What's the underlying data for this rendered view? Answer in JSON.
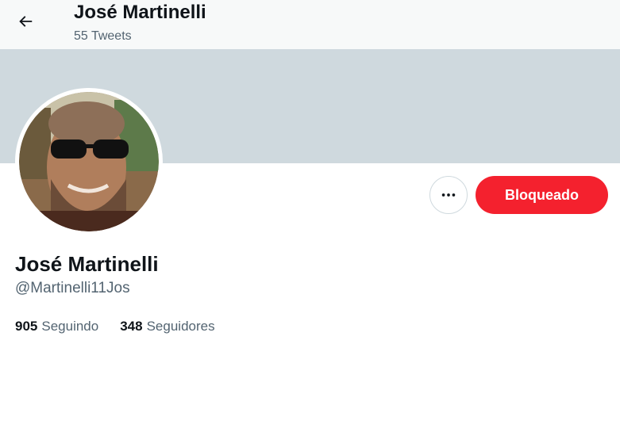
{
  "header": {
    "title": "José Martinelli",
    "subtitle": "55 Tweets",
    "back_icon": "arrow-left-icon"
  },
  "profile": {
    "name": "José Martinelli",
    "handle": "@Martinelli11Jos",
    "avatar_description_icon": "avatar-photo",
    "banner_color": "#cfd9de"
  },
  "actions": {
    "more_icon": "more-horizontal-icon",
    "blocked_label": "Bloqueado",
    "blocked_color": "#f4212e"
  },
  "stats": {
    "following_count": "905",
    "following_label": "Seguindo",
    "followers_count": "348",
    "followers_label": "Seguidores"
  }
}
